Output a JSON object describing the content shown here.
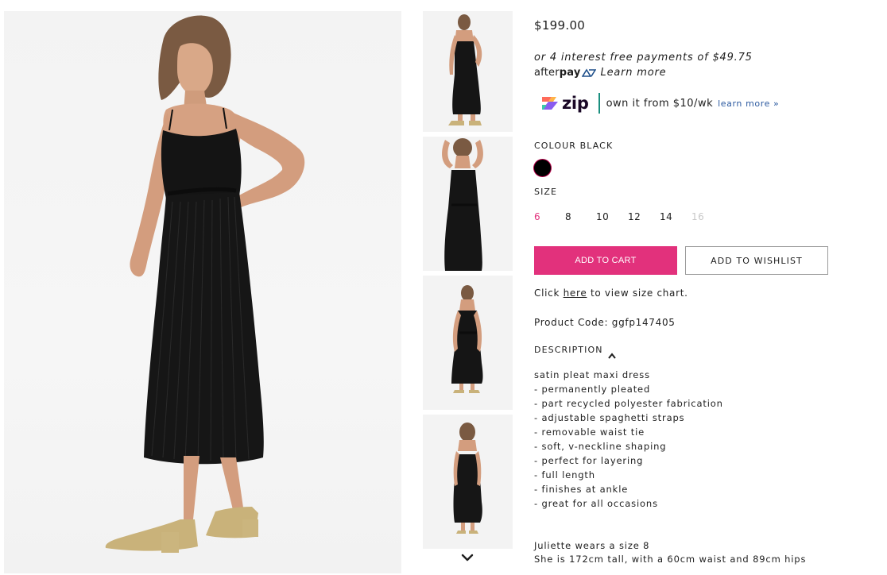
{
  "product": {
    "price": "$199.00",
    "afterpay": {
      "line": "or 4 interest free payments of $49.75",
      "logo_bold": "after",
      "logo_light": "pay",
      "learn_more": "Learn more"
    },
    "zip": {
      "logo_text": "zip",
      "text": "own it from $10/wk",
      "learn_more": "learn more »"
    },
    "colour": {
      "label": "COLOUR BLACK",
      "swatch_color": "#000000"
    },
    "size": {
      "label": "SIZE",
      "options": [
        "6",
        "8",
        "10",
        "12",
        "14",
        "16"
      ],
      "selected": "6",
      "unavailable": [
        "16"
      ]
    },
    "buttons": {
      "add_to_cart": "ADD TO CART",
      "add_to_wishlist": "ADD TO WISHLIST"
    },
    "size_chart": {
      "prefix": "Click ",
      "link": "here",
      "suffix": " to view size chart."
    },
    "product_code": "Product Code: ggfp147405",
    "description": {
      "label": "DESCRIPTION",
      "lines": [
        "satin pleat maxi dress",
        "- permanently pleated",
        "- part recycled polyester fabrication",
        "- adjustable spaghetti straps",
        "- removable waist tie",
        "- soft, v-neckline shaping",
        "- perfect for layering",
        "- full length",
        "- finishes at ankle",
        "- great for all occasions"
      ]
    },
    "model_info": [
      "Juliette wears a size 8",
      "She is 172cm tall, with a 60cm waist and 89cm hips"
    ]
  },
  "gallery": {
    "thumbnail_count": 4,
    "scroll_icon": "chevron-down-icon"
  },
  "colors": {
    "accent_pink": "#e2317c",
    "zip_teal": "#1a8f7f",
    "link_blue": "#2c5aa0"
  }
}
